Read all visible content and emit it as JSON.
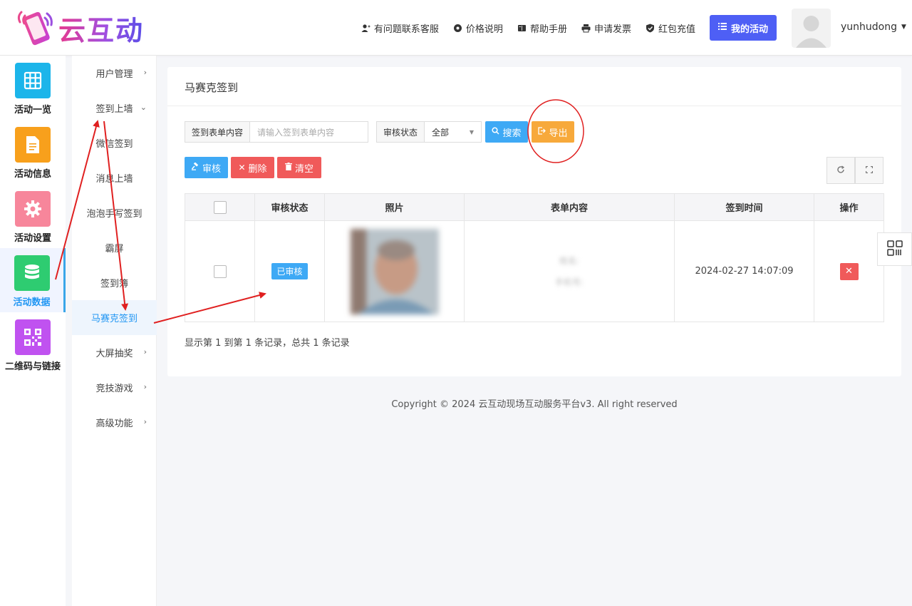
{
  "brand": {
    "name": "云互动"
  },
  "top_nav": {
    "links": [
      {
        "label": "有问题联系客服",
        "icon": "user-plus-icon"
      },
      {
        "label": "价格说明",
        "icon": "gear-badge-icon"
      },
      {
        "label": "帮助手册",
        "icon": "book-icon"
      },
      {
        "label": "申请发票",
        "icon": "printer-icon"
      },
      {
        "label": "红包充值",
        "icon": "shield-check-icon"
      }
    ],
    "my_activity": "我的活动",
    "username": "yunhudong"
  },
  "sidebar": {
    "items": [
      {
        "label": "活动一览",
        "icon": "grid-icon",
        "color": "#1cb5ea"
      },
      {
        "label": "活动信息",
        "icon": "document-icon",
        "color": "#f8a01c"
      },
      {
        "label": "活动设置",
        "icon": "gear-icon",
        "color": "#f7869b"
      },
      {
        "label": "活动数据",
        "icon": "database-icon",
        "color": "#2ecc71"
      },
      {
        "label": "二维码与链接",
        "icon": "qrcode-icon",
        "color": "#c052f0"
      }
    ]
  },
  "submenu": {
    "items": [
      {
        "label": "用户管理",
        "chev": "›"
      },
      {
        "label": "签到上墙",
        "chev": "⌄"
      },
      {
        "label": "微信签到",
        "chev": ""
      },
      {
        "label": "消息上墙",
        "chev": ""
      },
      {
        "label": "泡泡手写签到",
        "chev": ""
      },
      {
        "label": "霸屏",
        "chev": ""
      },
      {
        "label": "签到簿",
        "chev": ""
      },
      {
        "label": "马赛克签到",
        "chev": ""
      },
      {
        "label": "大屏抽奖",
        "chev": "›"
      },
      {
        "label": "竞技游戏",
        "chev": "›"
      },
      {
        "label": "高级功能",
        "chev": "›"
      }
    ]
  },
  "main": {
    "title": "马赛克签到",
    "filters": {
      "form_label": "签到表单内容",
      "form_placeholder": "请输入签到表单内容",
      "status_label": "审核状态",
      "status_value": "全部"
    },
    "buttons": {
      "search": "搜索",
      "export": "导出",
      "approve": "审核",
      "delete": "删除",
      "clear": "清空"
    },
    "table": {
      "columns": [
        "审核状态",
        "照片",
        "表单内容",
        "签到时间",
        "操作"
      ],
      "rows": [
        {
          "status": "已审核",
          "form_line1": "姓名:",
          "form_line2": "手机号:",
          "time": "2024-02-27 14:07:09"
        }
      ]
    },
    "pager": "显示第 1 到第 1 条记录，总共 1 条记录"
  },
  "footer": "Copyright © 2024 云互动现场互动服务平台v3. All right reserved",
  "colors": {
    "accent": "#3ea9f5",
    "export": "#f7a93b",
    "danger": "#f05a5a",
    "primary": "#4e5ff5"
  }
}
